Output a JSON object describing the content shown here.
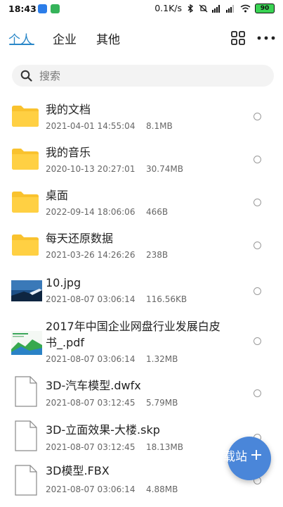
{
  "status_bar": {
    "time": "18:43",
    "network_speed": "0.1K/s",
    "battery": "90"
  },
  "tabs": [
    {
      "label": "个人",
      "active": true
    },
    {
      "label": "企业",
      "active": false
    },
    {
      "label": "其他",
      "active": false
    }
  ],
  "search": {
    "placeholder": "搜索"
  },
  "files": [
    {
      "name": "我的文档",
      "date": "2021-04-01 14:55:04",
      "size": "8.1MB",
      "type": "folder"
    },
    {
      "name": "我的音乐",
      "date": "2020-10-13 20:27:01",
      "size": "30.74MB",
      "type": "folder"
    },
    {
      "name": "桌面",
      "date": "2022-09-14 18:06:06",
      "size": "466B",
      "type": "folder"
    },
    {
      "name": "每天还原数据",
      "date": "2021-03-26 14:26:26",
      "size": "238B",
      "type": "folder"
    },
    {
      "name": "10.jpg",
      "date": "2021-08-07 03:06:14",
      "size": "116.56KB",
      "type": "image"
    },
    {
      "name_line1": "2017年中国企业网盘行业发展白皮",
      "name_line2": "书_.pdf",
      "date": "2021-08-07 03:06:14",
      "size": "1.32MB",
      "type": "pdf"
    },
    {
      "name": "3D-汽车模型.dwfx",
      "date": "2021-08-07 03:12:45",
      "size": "5.79MB",
      "type": "file"
    },
    {
      "name": "3D-立面效果-大楼.skp",
      "date": "2021-08-07 03:12:45",
      "size": "18.13MB",
      "type": "file"
    },
    {
      "name": "3D模型.FBX",
      "date": "2021-08-07 03:06:14",
      "size": "4.88MB",
      "type": "file"
    }
  ],
  "fab": {
    "label": "载站"
  },
  "colors": {
    "accent": "#2a87c8",
    "folder": "#f9c22e",
    "fab": "#4a86d9"
  }
}
